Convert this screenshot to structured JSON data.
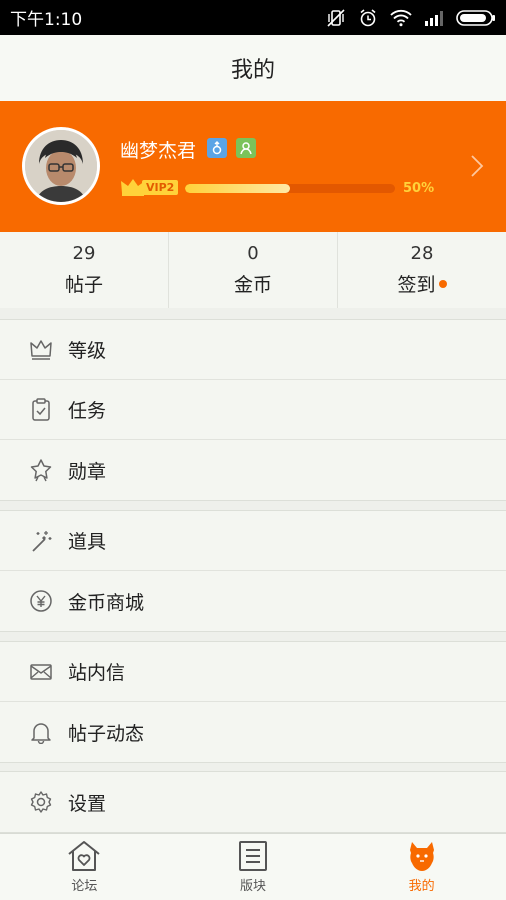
{
  "status_bar": {
    "time": "下午1:10"
  },
  "header": {
    "title": "我的"
  },
  "profile": {
    "username": "幽梦杰君",
    "vip_level": "VIP2",
    "progress_percent": 50,
    "progress_text": "50%"
  },
  "stats": [
    {
      "value": "29",
      "label": "帖子"
    },
    {
      "value": "0",
      "label": "金币"
    },
    {
      "value": "28",
      "label": "签到"
    }
  ],
  "menu_groups": [
    [
      {
        "label": "等级",
        "icon": "crown-icon"
      },
      {
        "label": "任务",
        "icon": "clipboard-check-icon"
      },
      {
        "label": "勋章",
        "icon": "medal-icon"
      }
    ],
    [
      {
        "label": "道具",
        "icon": "magic-wand-icon"
      },
      {
        "label": "金币商城",
        "icon": "yen-coin-icon"
      }
    ],
    [
      {
        "label": "站内信",
        "icon": "mail-icon"
      },
      {
        "label": "帖子动态",
        "icon": "bell-icon"
      }
    ],
    [
      {
        "label": "设置",
        "icon": "gear-icon"
      }
    ]
  ],
  "tabs": [
    {
      "label": "论坛",
      "icon": "house-heart-icon",
      "active": false
    },
    {
      "label": "版块",
      "icon": "document-list-icon",
      "active": false
    },
    {
      "label": "我的",
      "icon": "mi-bunny-icon",
      "active": true
    }
  ],
  "colors": {
    "accent": "#f86a00",
    "vip_gold": "#ffd23a",
    "background": "#eef0eb"
  }
}
